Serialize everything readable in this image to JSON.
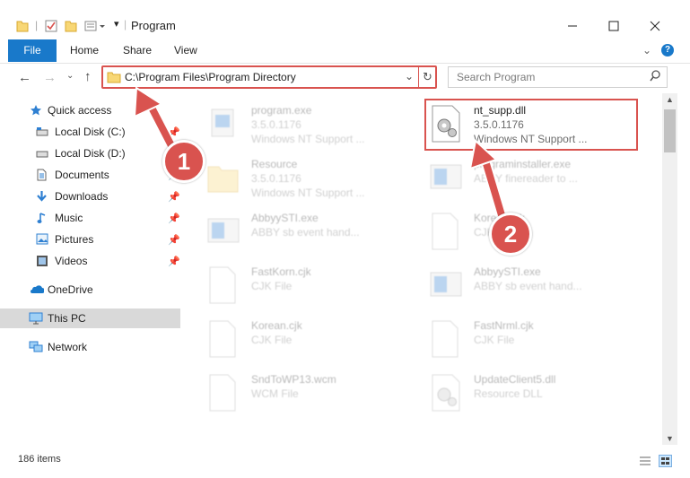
{
  "window": {
    "title": "Program"
  },
  "ribbon": {
    "tabs": [
      {
        "label": "File"
      },
      {
        "label": "Home"
      },
      {
        "label": "Share"
      },
      {
        "label": "View"
      }
    ]
  },
  "address": {
    "path": "C:\\Program Files\\Program Directory"
  },
  "search": {
    "placeholder": "Search Program"
  },
  "sidebar": {
    "items": [
      {
        "label": "Quick access"
      },
      {
        "label": "Local Disk (C:)"
      },
      {
        "label": "Local Disk (D:)"
      },
      {
        "label": "Documents"
      },
      {
        "label": "Downloads"
      },
      {
        "label": "Music"
      },
      {
        "label": "Pictures"
      },
      {
        "label": "Videos"
      },
      {
        "label": "OneDrive"
      },
      {
        "label": "This PC"
      },
      {
        "label": "Network"
      }
    ]
  },
  "files": [
    {
      "name": "program.exe",
      "line2": "3.5.0.1176",
      "line3": "Windows NT Support ..."
    },
    {
      "name": "nt_supp.dll",
      "line2": "3.5.0.1176",
      "line3": "Windows NT Support ..."
    },
    {
      "name": "Resource",
      "line2": "3.5.0.1176",
      "line3": "Windows NT Support ..."
    },
    {
      "name": "programinstaller.exe",
      "line2": "ABBY finereader to ...",
      "line3": ""
    },
    {
      "name": "AbbyySTI.exe",
      "line2": "ABBY sb event hand...",
      "line3": ""
    },
    {
      "name": "Korean.cjk",
      "line2": "CJK File",
      "line3": ""
    },
    {
      "name": "FastKorn.cjk",
      "line2": "CJK File",
      "line3": ""
    },
    {
      "name": "AbbyySTI.exe",
      "line2": "ABBY sb event hand...",
      "line3": ""
    },
    {
      "name": "Korean.cjk",
      "line2": "CJK File",
      "line3": ""
    },
    {
      "name": "FastNrml.cjk",
      "line2": "CJK File",
      "line3": ""
    },
    {
      "name": "SndToWP13.wcm",
      "line2": "WCM File",
      "line3": ""
    },
    {
      "name": "UpdateClient5.dll",
      "line2": "Resource DLL",
      "line3": ""
    }
  ],
  "status": {
    "count": "186 items"
  },
  "callouts": [
    {
      "number": "1"
    },
    {
      "number": "2"
    }
  ],
  "colors": {
    "accent": "#1979ca",
    "highlight": "#d9534f",
    "folder": "#f8d775",
    "selected": "#cce8ff"
  }
}
